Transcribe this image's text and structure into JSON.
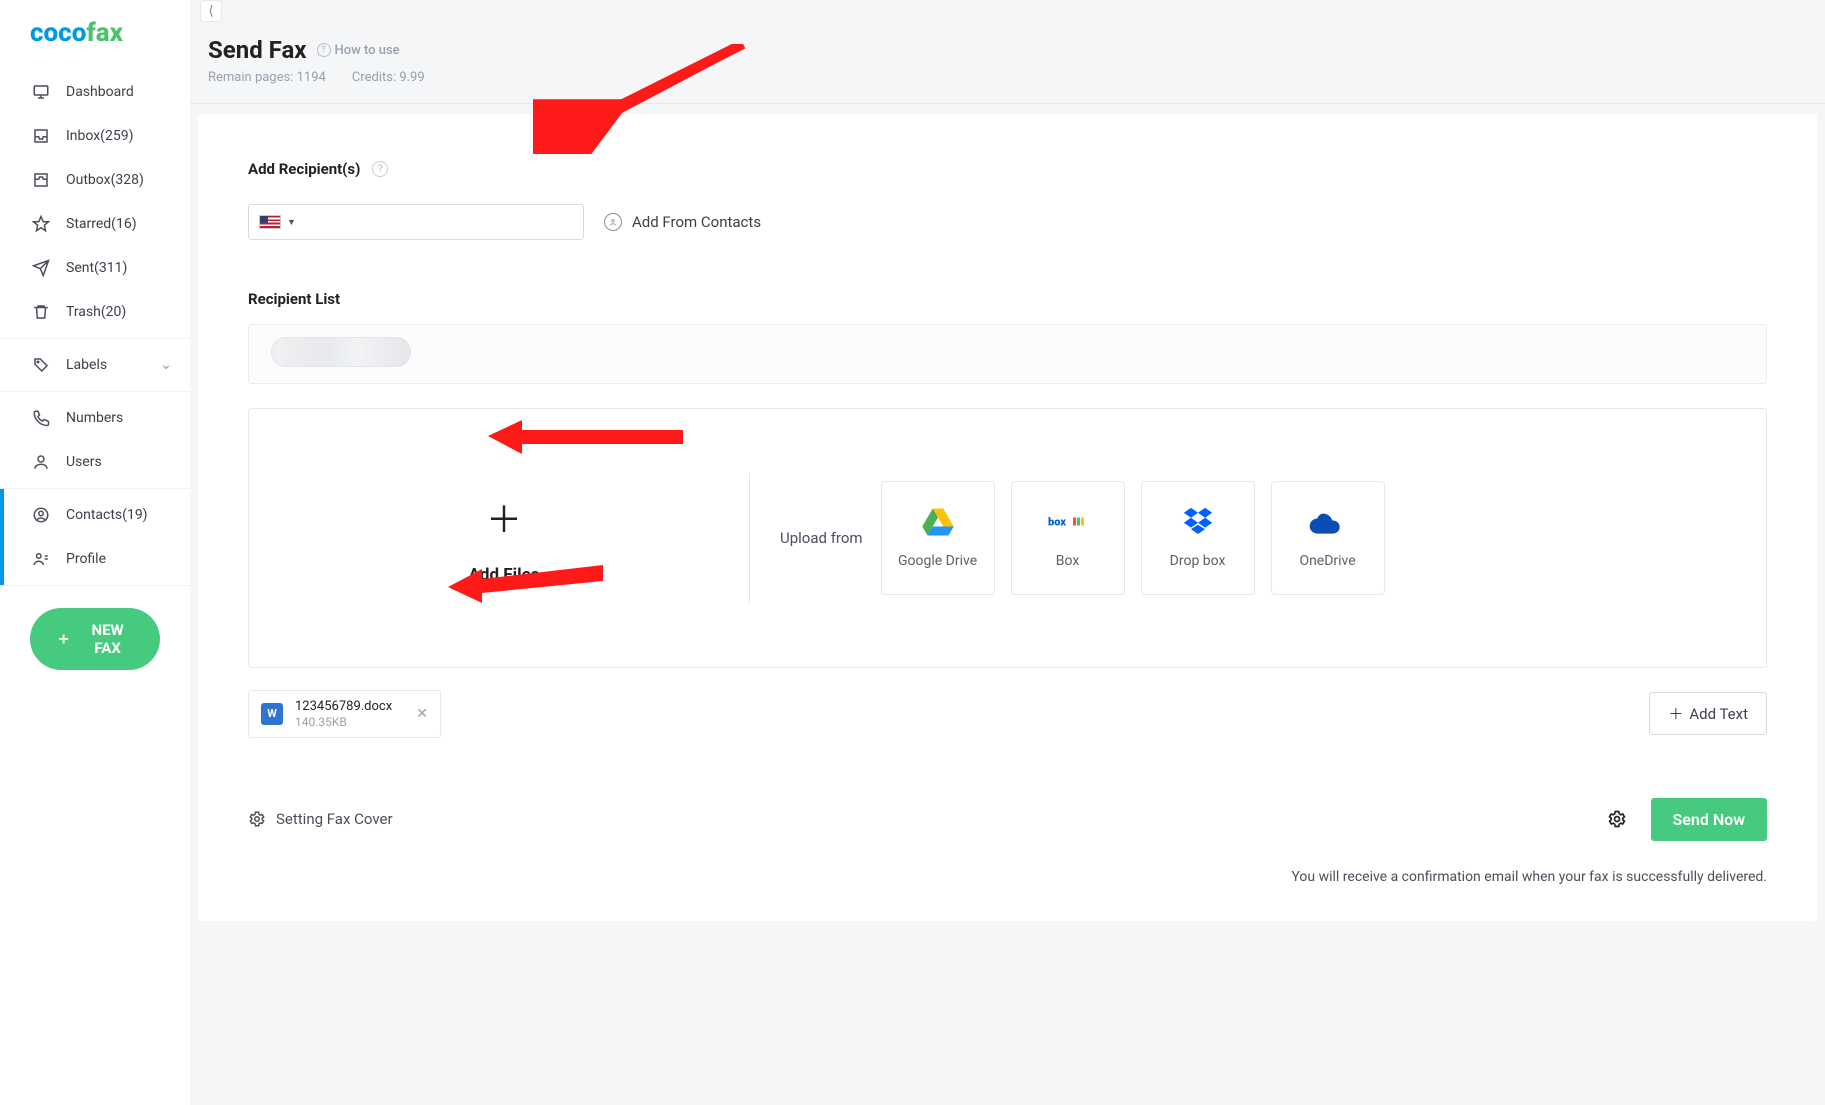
{
  "brand": {
    "part1": "coco",
    "part2": "fax"
  },
  "sidebar": {
    "dashboard": "Dashboard",
    "inbox": "Inbox(259)",
    "outbox": "Outbox(328)",
    "starred": "Starred(16)",
    "sent": "Sent(311)",
    "trash": "Trash(20)",
    "labels": "Labels",
    "numbers": "Numbers",
    "users": "Users",
    "contacts": "Contacts(19)",
    "profile": "Profile",
    "new_fax": "NEW FAX"
  },
  "header": {
    "title": "Send Fax",
    "how_to_use": "How to use",
    "remain_pages_label": "Remain pages:",
    "remain_pages_value": "1194",
    "credits_label": "Credits:",
    "credits_value": "9.99"
  },
  "recipients": {
    "label": "Add Recipient(s)",
    "input_value": "",
    "country": "US",
    "add_from_contacts": "Add From Contacts",
    "list_label": "Recipient List"
  },
  "upload": {
    "add_files": "Add Files",
    "upload_from": "Upload from",
    "providers": {
      "gdrive": "Google Drive",
      "box": "Box",
      "dropbox": "Drop box",
      "onedrive": "OneDrive"
    }
  },
  "files": {
    "attached": {
      "name": "123456789.docx",
      "size": "140.35KB",
      "type_badge": "W"
    },
    "add_text": "Add Text"
  },
  "footer": {
    "setting_cover": "Setting Fax Cover",
    "send": "Send Now",
    "confirm_note": "You will receive a confirmation email when your fax is successfully delivered."
  }
}
